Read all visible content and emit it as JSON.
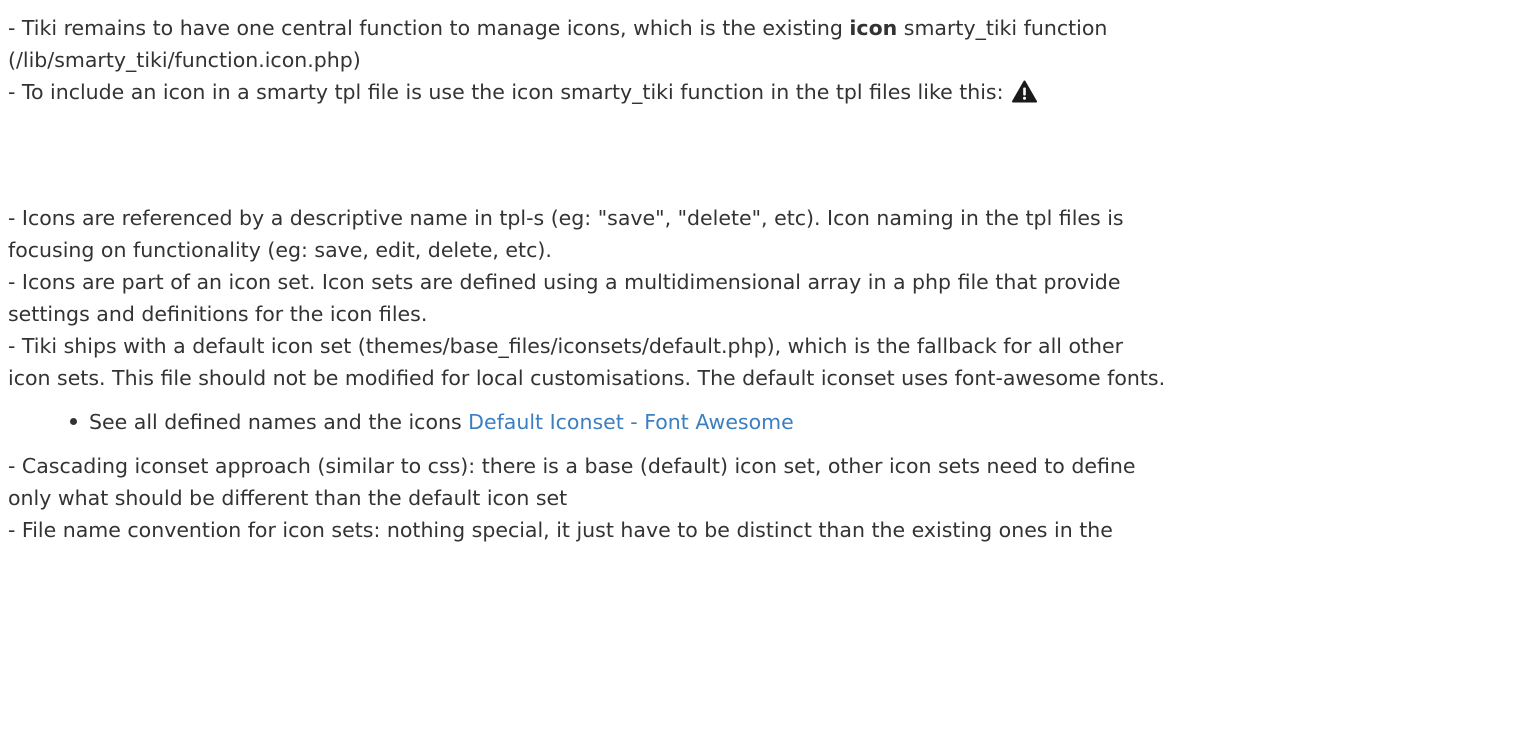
{
  "paragraphs": {
    "p1_line1_pre": "- Tiki remains to have one central function to manage icons, which is the existing ",
    "p1_line1_bold": "icon",
    "p1_line1_post": " smarty_tiki function",
    "p1_line2": "(/lib/smarty_tiki/function.icon.php)",
    "p2_line1": "- To include an icon in a smarty tpl file is use the icon smarty_tiki function in the tpl files like this:",
    "p3_line1": "- Icons are referenced by a descriptive name in tpl-s (eg: \"save\", \"delete\", etc). Icon naming in the tpl files is",
    "p3_line2": "focusing on functionality (eg: save, edit, delete, etc).",
    "p4_line1": "- Icons are part of an icon set. Icon sets are defined using a multidimensional array in a php file that provide",
    "p4_line2": "settings and definitions for the icon files.",
    "p5_line1": "- Tiki ships with a default icon set (themes/base_files/iconsets/default.php), which is the fallback for all other",
    "p5_line2": "icon sets. This file should not be modified for local customisations. The default iconset uses font-awesome fonts.",
    "bullet_text": "See all defined names and the icons ",
    "bullet_link": "Default Iconset - Font Awesome",
    "p6_line1": "- Cascading iconset approach (similar to css): there is a base (default) icon set, other icon sets need to define",
    "p6_line2": "only what should be different than the default icon set",
    "p7_line1": "- File name convention for icon sets: nothing special, it just have to be distinct than the existing ones in the"
  },
  "icons": {
    "warning": "warning-triangle-icon"
  }
}
